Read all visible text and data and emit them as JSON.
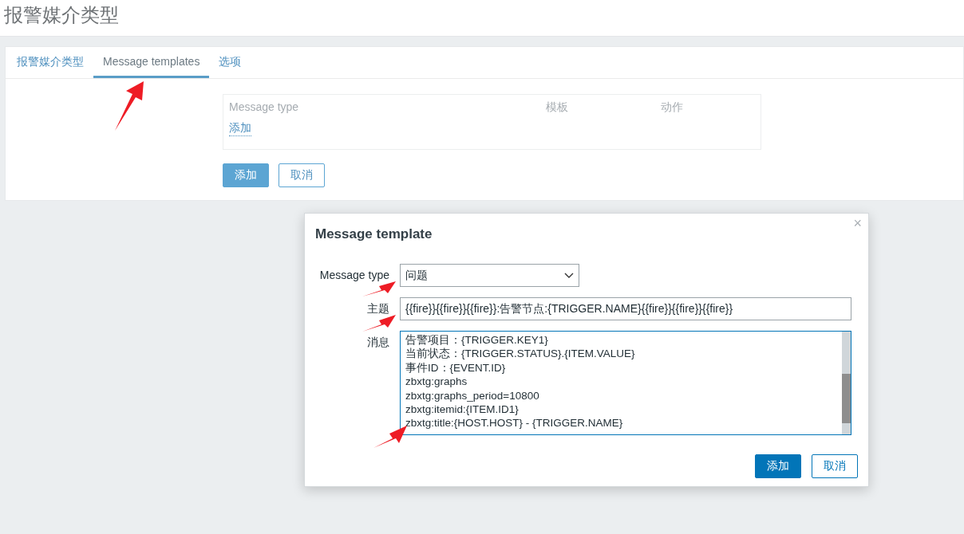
{
  "page_title": "报警媒介类型",
  "tabs": [
    {
      "label": "报警媒介类型",
      "selected": false
    },
    {
      "label": "Message templates",
      "selected": true
    },
    {
      "label": "选项",
      "selected": false
    }
  ],
  "templates_table": {
    "columns": [
      "Message type",
      "模板",
      "动作"
    ],
    "add_link": "添加"
  },
  "buttons": [
    {
      "label": "添加",
      "kind": "primary"
    },
    {
      "label": "取消",
      "kind": "secondary"
    }
  ],
  "dialog": {
    "title": "Message template",
    "close": "×",
    "message_type": {
      "label": "Message type",
      "value": "问题"
    },
    "subject": {
      "label": "主题",
      "value": "{{fire}}{{fire}}{{fire}}:告警节点:{TRIGGER.NAME}{{fire}}{{fire}}{{fire}}"
    },
    "message": {
      "label": "消息",
      "lines": [
        "告警项目：{TRIGGER.KEY1}",
        "当前状态：{TRIGGER.STATUS}.{ITEM.VALUE}",
        "事件ID：{EVENT.ID}",
        "zbxtg:graphs",
        "zbxtg:graphs_period=10800",
        "zbxtg:itemid:{ITEM.ID1}",
        "zbxtg:title:{HOST.HOST} - {TRIGGER.NAME}"
      ]
    },
    "buttons": [
      {
        "label": "添加",
        "kind": "primary"
      },
      {
        "label": "取消",
        "kind": "secondary"
      }
    ]
  }
}
